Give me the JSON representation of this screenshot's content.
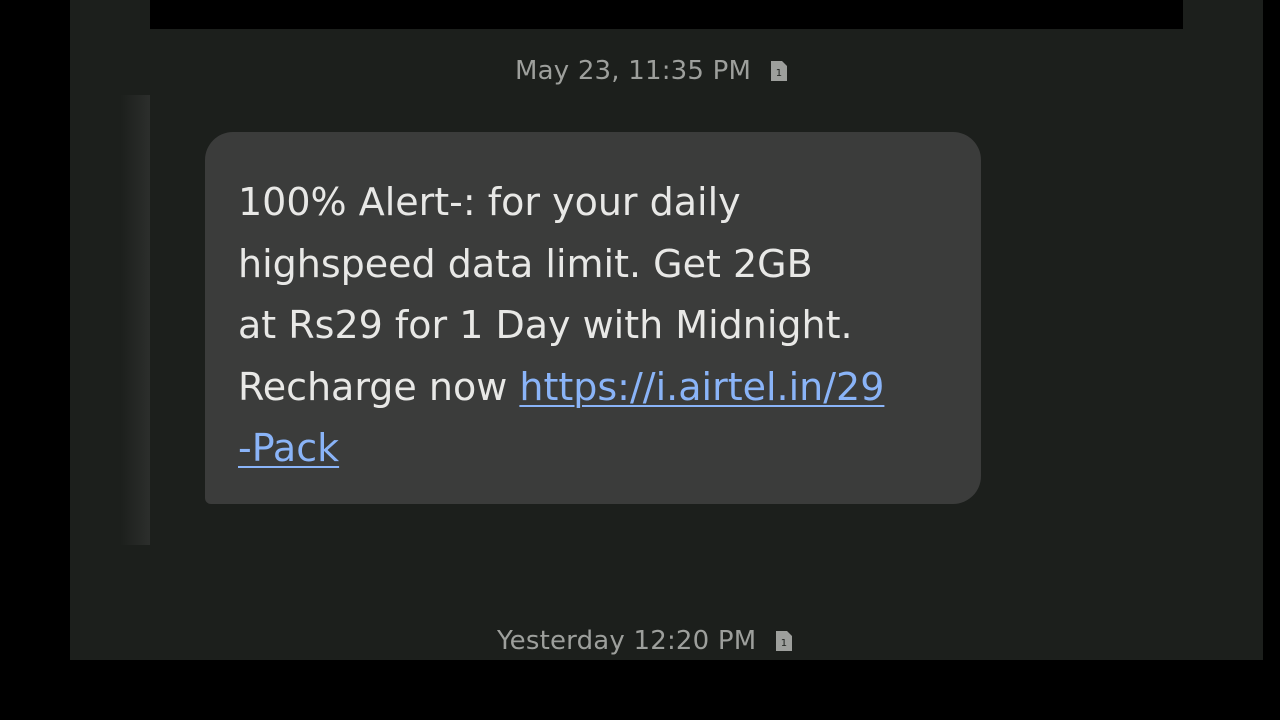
{
  "conversation": {
    "messages": [
      {
        "timestamp": "May 23, 11:35 PM",
        "sim_icon": "sim-card-1-icon",
        "text_lines": [
          "100% Alert-: for your daily",
          "highspeed data limit. Get 2GB",
          "at Rs29 for 1 Day with Midnight.",
          "Recharge now "
        ],
        "link_part1": "https://i.airtel.in/29",
        "link_part2": "-Pack"
      },
      {
        "timestamp": "Yesterday 12:20 PM",
        "sim_icon": "sim-card-1-icon"
      }
    ]
  },
  "colors": {
    "screen_bg": "#1c1f1c",
    "bubble_bg": "#3b3c3b",
    "text": "#e8e8e6",
    "timestamp": "#9d9f9c",
    "link": "#8ab4f8"
  }
}
